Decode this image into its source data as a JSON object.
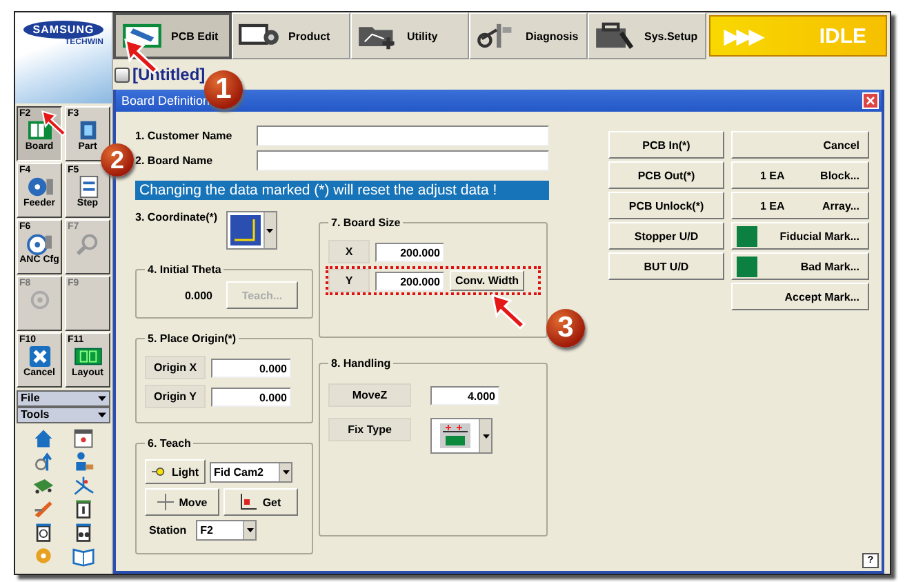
{
  "logo": {
    "brand": "SAMSUNG",
    "sub": "TECHWIN"
  },
  "tabs": [
    {
      "label": "PCB Edit",
      "selected": true
    },
    {
      "label": "Product",
      "selected": false
    },
    {
      "label": "Utility",
      "selected": false
    },
    {
      "label": "Diagnosis",
      "selected": false
    },
    {
      "label": "Sys.Setup",
      "selected": false
    }
  ],
  "status": {
    "arrows": "▶▶▶",
    "label": "IDLE"
  },
  "document": {
    "title": "[Untitled]"
  },
  "function_keys": [
    {
      "key": "F2",
      "label": "Board",
      "selected": true,
      "disabled": false
    },
    {
      "key": "F3",
      "label": "Part",
      "selected": false,
      "disabled": false
    },
    {
      "key": "F4",
      "label": "Feeder",
      "selected": false,
      "disabled": false
    },
    {
      "key": "F5",
      "label": "Step",
      "selected": false,
      "disabled": false
    },
    {
      "key": "F6",
      "label": "ANC Cfg",
      "selected": false,
      "disabled": false
    },
    {
      "key": "F7",
      "selected": false,
      "disabled": true
    },
    {
      "key": "F8",
      "selected": false,
      "disabled": true
    },
    {
      "key": "F9",
      "selected": false,
      "disabled": true
    },
    {
      "key": "F10",
      "label": "Cancel",
      "selected": false,
      "disabled": false
    },
    {
      "key": "F11",
      "label": "Layout",
      "selected": false,
      "disabled": false
    }
  ],
  "menus": [
    {
      "label": "File",
      "expanded": false
    },
    {
      "label": "Tools",
      "expanded": false
    }
  ],
  "dialog": {
    "title": "Board Definition",
    "fields": [
      {
        "label": "1. Customer Name"
      },
      {
        "label": "2. Board Name"
      }
    ],
    "warning": "Changing the data marked (*) will reset the adjust data !",
    "coordinate": {
      "label": "3. Coordinate(*)"
    },
    "initial_theta": {
      "title": "4. Initial Theta",
      "value": "0.000",
      "button": {
        "label": "Teach...",
        "disabled": true
      }
    },
    "place_origin": {
      "title": "5. Place Origin(*)",
      "rows": [
        {
          "label": "Origin X",
          "value": "0.000"
        },
        {
          "label": "Origin Y",
          "value": "0.000"
        }
      ]
    },
    "teach": {
      "title": "6. Teach",
      "light": "Light",
      "camera": "Fid Cam2",
      "move": "Move",
      "get": "Get",
      "station_label": "Station",
      "station": "F2"
    },
    "board_size": {
      "title": "7. Board Size",
      "rows": [
        {
          "label": "X",
          "value": "200.000"
        },
        {
          "label": "Y",
          "value": "200.000"
        }
      ],
      "button": "Conv. Width"
    },
    "handling": {
      "title": "8. Handling",
      "rows": [
        {
          "label": "MoveZ",
          "value": "4.000"
        }
      ],
      "fix_type": "Fix Type"
    },
    "left_buttons": [
      "PCB In(*)",
      "PCB Out(*)",
      "PCB Unlock(*)",
      "Stopper U/D",
      "BUT U/D"
    ],
    "right_buttons": [
      {
        "kind": "plain",
        "label": "Cancel"
      },
      {
        "kind": "count",
        "count": "1 EA",
        "label": "Block..."
      },
      {
        "kind": "count",
        "count": "1 EA",
        "label": "Array..."
      },
      {
        "kind": "swatch",
        "color": "#0b8040",
        "label": "Fiducial Mark..."
      },
      {
        "kind": "swatch",
        "color": "#0b8040",
        "label": "Bad Mark..."
      },
      {
        "kind": "plain",
        "label": "Accept Mark..."
      }
    ],
    "help": "?"
  },
  "annotations": [
    {
      "number": "1"
    },
    {
      "number": "2"
    },
    {
      "number": "3"
    }
  ]
}
